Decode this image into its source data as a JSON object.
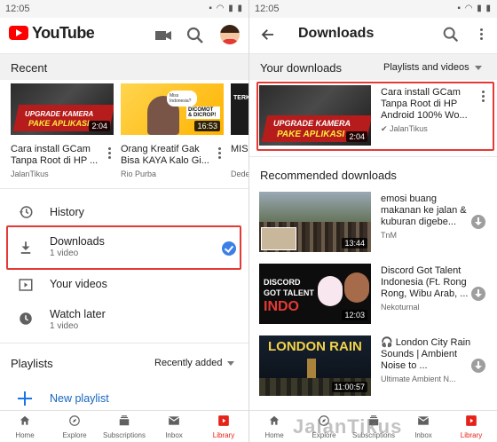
{
  "left": {
    "status": {
      "time": "12:05",
      "icons": "▪ ◠ ▮ ▮"
    },
    "appbar": {
      "logo_text": "YouTube",
      "icons": [
        "camera-icon",
        "search-icon",
        "avatar"
      ]
    },
    "recent": {
      "title": "Recent",
      "videos": [
        {
          "title": "Cara install GCam Tanpa Root di HP ...",
          "channel": "JalanTikus",
          "duration": "2:04",
          "thumb_line1": "UPGRADE KAMERA",
          "thumb_line2": "PAKE APLIKASI"
        },
        {
          "title": "Orang Kreatif Gak Bisa KAYA Kalo Gi...",
          "channel": "Rio Purba",
          "duration": "16:53",
          "thumb_bubble": "Miss Indonesia?",
          "thumb_tag": "DICOMOT & DICROP!"
        },
        {
          "title": "MIS Tran",
          "channel": "Dede",
          "thumb_text": "TERK NEG KEMB"
        }
      ]
    },
    "menu": [
      {
        "label": "History",
        "icon": "history-icon"
      },
      {
        "label": "Downloads",
        "sub": "1 video",
        "icon": "download-icon"
      },
      {
        "label": "Your videos",
        "icon": "video-icon"
      },
      {
        "label": "Watch later",
        "sub": "1 video",
        "icon": "clock-icon"
      }
    ],
    "playlists": {
      "title": "Playlists",
      "sort": "Recently added",
      "new_label": "New playlist"
    }
  },
  "nav": [
    "Home",
    "Explore",
    "Subscriptions",
    "Inbox",
    "Library"
  ],
  "right": {
    "status": {
      "time": "12:05",
      "icons": "▪ ◠ ▮ ▮"
    },
    "title": "Downloads",
    "your_downloads": {
      "title": "Your downloads",
      "filter": "Playlists and videos",
      "items": [
        {
          "title": "Cara install GCam Tanpa Root di HP Android 100% Wo...",
          "channel": "JalanTikus",
          "duration": "2:04",
          "thumb_line1": "UPGRADE KAMERA",
          "thumb_line2": "PAKE APLIKASI"
        }
      ]
    },
    "recommended": {
      "title": "Recommended downloads",
      "items": [
        {
          "title": "emosi buang makanan ke jalan & kuburan digebe...",
          "channel": "TnM",
          "duration": "13:44"
        },
        {
          "title": "Discord Got Talent Indonesia (Ft. Rong Rong, Wibu Arab, ...",
          "channel": "Nekoturnal",
          "duration": "12:03",
          "thumb_l1": "DISCORD",
          "thumb_l2": "GOT TALENT",
          "thumb_l3": "INDO"
        },
        {
          "title": "🎧 London City Rain Sounds | Ambient Noise to ...",
          "channel": "Ultimate Ambient N...",
          "duration": "11:00:57",
          "thumb_text": "LONDON RAIN"
        }
      ]
    },
    "watermark": "JalanTikus"
  },
  "colors": {
    "youtube_red": "#ff0000",
    "highlight_red": "#e53935",
    "check_blue": "#3d7fe6",
    "link_blue": "#1565c0"
  }
}
